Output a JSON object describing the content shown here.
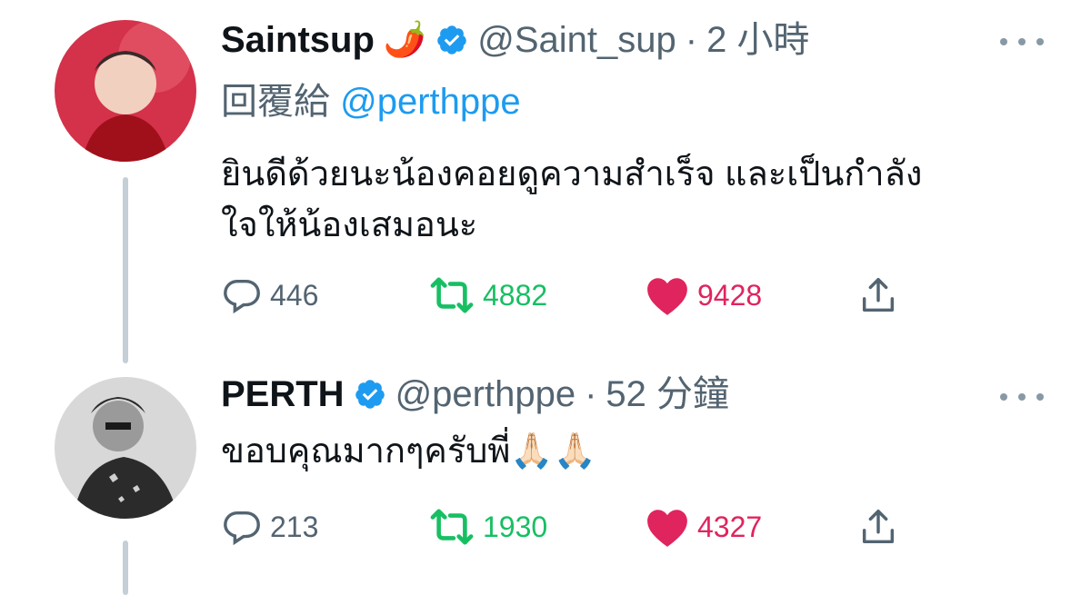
{
  "tweets": [
    {
      "name": "Saintsup",
      "emoji": "🌶️",
      "handle": "@Saint_sup",
      "dot": "·",
      "time": "2 小時",
      "reply_prefix": "回覆給",
      "reply_handle": "@perthppe",
      "text_line1": "ยินดีด้วยนะน้องคอยดูความสำเร็จ และเป็นกำลัง",
      "text_line2": "ใจให้น้องเสมอนะ",
      "replies": "446",
      "retweets": "4882",
      "likes": "9428"
    },
    {
      "name": "PERTH",
      "handle": "@perthppe",
      "dot": "·",
      "time": "52 分鐘",
      "text": "ขอบคุณมากๆครับพี่🙏🏻🙏🏻",
      "replies": "213",
      "retweets": "1930",
      "likes": "4327"
    }
  ],
  "colors": {
    "link": "#1d9bf0",
    "retweet": "#17bf63",
    "like": "#e0245e",
    "muted": "#536471"
  },
  "icons": [
    "reply-icon",
    "retweet-icon",
    "heart-icon",
    "share-icon",
    "verified-badge-icon",
    "more-icon"
  ]
}
